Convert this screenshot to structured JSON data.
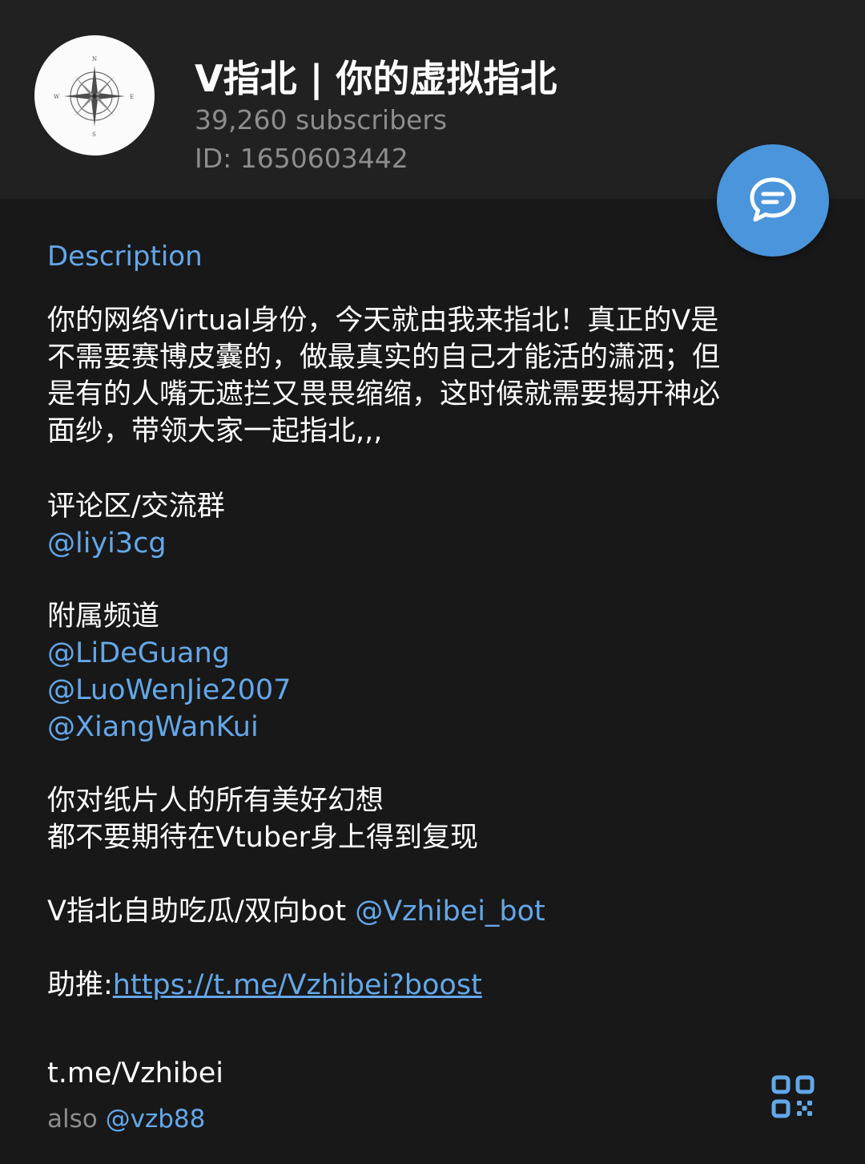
{
  "channel": {
    "title": "V指北 | 你的虚拟指北",
    "subscribers": "39,260 subscribers",
    "id": "ID: 1650603442",
    "avatar_icon": "compass-rose-icon"
  },
  "actions": {
    "chat_icon": "chat-bubble-icon",
    "qr_icon": "qr-code-icon"
  },
  "description": {
    "label": "Description",
    "intro_lines": [
      "你的网络Virtual身份，今天就由我来指北！真正的V是",
      "不需要赛博皮囊的，做最真实的自己才能活的潇洒；但",
      "是有的人嘴无遮拦又畏畏缩缩，这时候就需要揭开神必",
      "面纱，带领大家一起指北,,,"
    ],
    "comments_heading": "评论区/交流群",
    "comments_link": "@liyi3cg",
    "affiliates_heading": "附属频道",
    "affiliate_links": [
      "@LiDeGuang",
      "@LuoWenJie2007",
      "@XiangWanKui"
    ],
    "closing_lines": [
      "你对纸片人的所有美好幻想",
      "都不要期待在Vtuber身上得到复现"
    ],
    "bot_text": "V指北自助吃瓜/双向bot ",
    "bot_link": "@Vzhibei_bot",
    "boost_text": "助推:",
    "boost_url": "https://t.me/Vzhibei?boost"
  },
  "link": {
    "url": "t.me/Vzhibei",
    "also_prefix": "also ",
    "also_handle": "@vzb88"
  },
  "colors": {
    "accent": "#64a7e9",
    "fab": "#4a95dc",
    "header_bg": "#212121",
    "page_bg": "#181818",
    "muted_text": "#8d8d8d"
  }
}
